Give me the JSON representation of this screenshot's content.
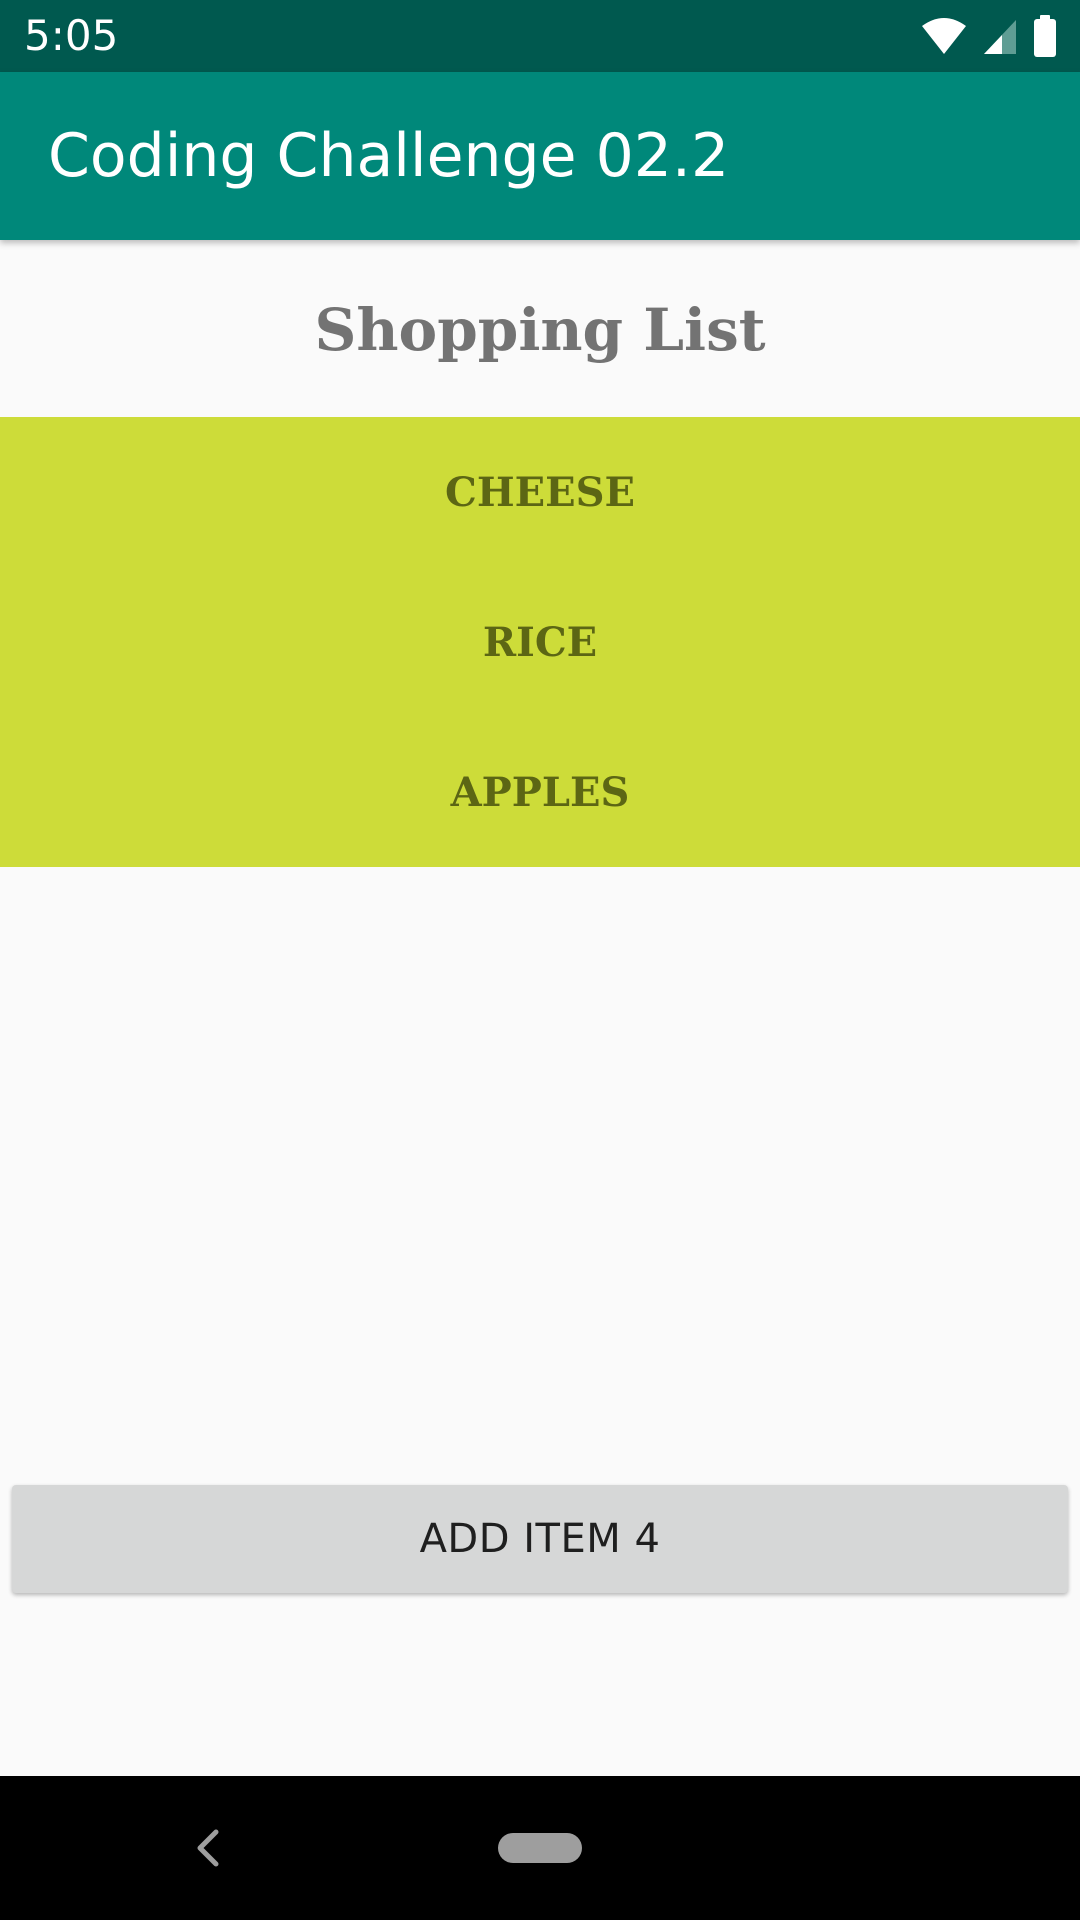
{
  "status_bar": {
    "time": "5:05",
    "icons": [
      "wifi-icon",
      "signal-icon",
      "battery-icon"
    ]
  },
  "app_bar": {
    "title": "Coding Challenge 02.2"
  },
  "main": {
    "heading": "Shopping List",
    "items": [
      {
        "label": "CHEESE"
      },
      {
        "label": "RICE"
      },
      {
        "label": "APPLES"
      }
    ],
    "add_button_label": "ADD ITEM 4"
  },
  "nav_bar": {
    "icons": [
      "back-icon",
      "home-pill-icon"
    ]
  },
  "colors": {
    "status_bar": "#00594f",
    "app_bar": "#00887a",
    "list_background": "#cddc39",
    "item_text": "#5c6614",
    "heading_text": "#737373",
    "button_background": "#d6d7d7"
  }
}
